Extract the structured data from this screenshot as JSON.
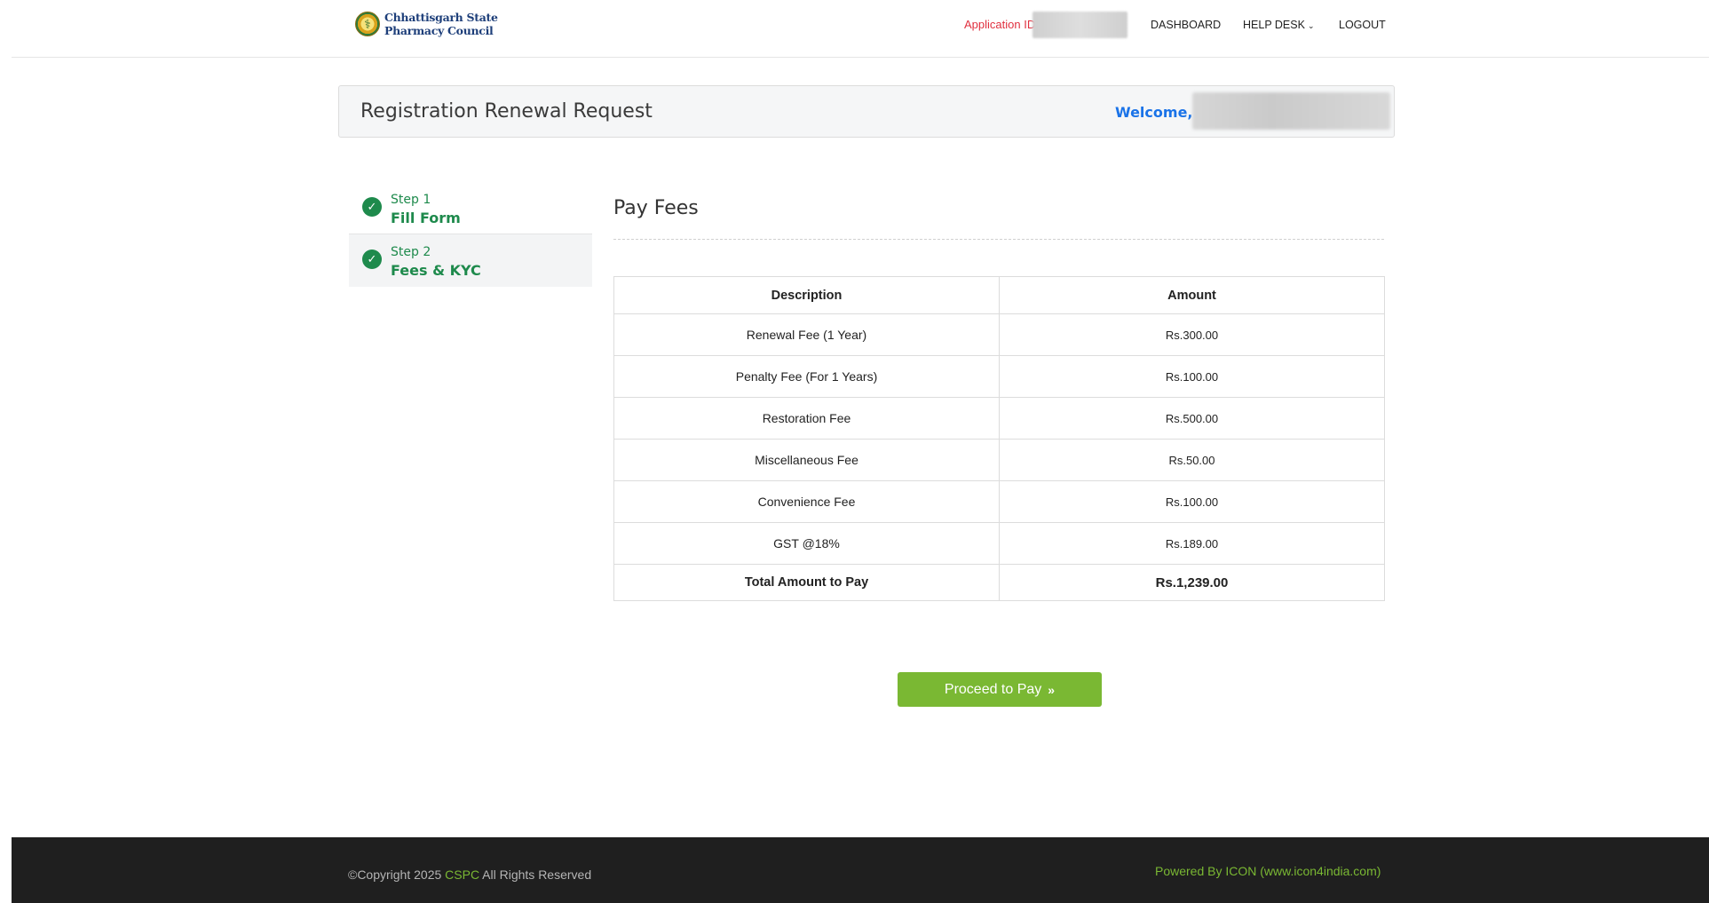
{
  "header": {
    "logo_line1": "Chhattisgarh State",
    "logo_line2": "Pharmacy Council",
    "application_id_label": "Application ID",
    "nav": {
      "dashboard": "DASHBOARD",
      "help_desk": "HELP DESK",
      "logout": "LOGOUT"
    }
  },
  "page": {
    "title": "Registration Renewal Request",
    "welcome": "Welcome, S"
  },
  "steps": [
    {
      "num": "Step 1",
      "name": "Fill Form",
      "status": "complete"
    },
    {
      "num": "Step 2",
      "name": "Fees & KYC",
      "status": "complete"
    }
  ],
  "pay": {
    "title": "Pay Fees",
    "table": {
      "headers": [
        "Description",
        "Amount"
      ],
      "rows": [
        {
          "description": "Renewal Fee (1 Year)",
          "amount": "Rs.300.00"
        },
        {
          "description": "Penalty Fee (For 1 Years)",
          "amount": "Rs.100.00"
        },
        {
          "description": "Restoration Fee",
          "amount": "Rs.500.00"
        },
        {
          "description": "Miscellaneous Fee",
          "amount": "Rs.50.00"
        },
        {
          "description": "Convenience Fee",
          "amount": "Rs.100.00"
        },
        {
          "description": "GST @18%",
          "amount": "Rs.189.00"
        }
      ],
      "total": {
        "description": "Total Amount to Pay",
        "amount": "Rs.1,239.00"
      }
    },
    "proceed_label": "Proceed to Pay"
  },
  "footer": {
    "copyright_prefix": "©Copyright 2025 ",
    "copyright_brand": "CSPC",
    "copyright_suffix": " All Rights Reserved",
    "powered_by": "Powered By ICON (www.icon4india.com)"
  },
  "colors": {
    "accent_green": "#7ab833",
    "step_green": "#1e8a4c",
    "welcome_blue": "#1a73e8",
    "app_id_red": "#e0303f"
  },
  "icons": [
    "check-circle-icon",
    "chevron-down-icon",
    "double-chevron-right-icon",
    "council-emblem-icon"
  ]
}
